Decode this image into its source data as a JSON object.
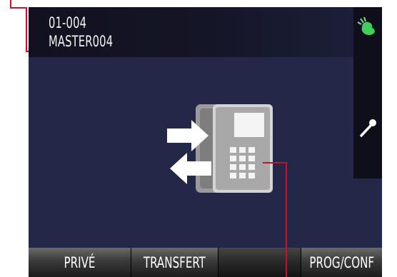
{
  "caller": {
    "number": "01-004",
    "name": "MASTER004"
  },
  "status_icons": [
    "call-active-icon",
    "microphone-icon"
  ],
  "center_icon": "station-transfer-icon",
  "softkeys": {
    "key1": "PRIVÉ",
    "key2": "TRANSFERT",
    "key3": "",
    "key4": "PROG/CONF"
  },
  "colors": {
    "screen_bg": "#242848",
    "callout": "#c8102e",
    "status_green": "#3fcf5b"
  }
}
